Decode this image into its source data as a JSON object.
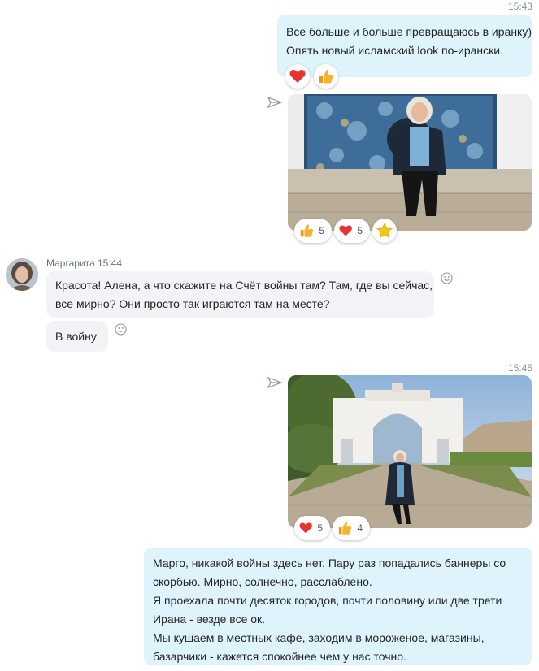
{
  "colors": {
    "outgoing_bubble": "#dff3fd",
    "incoming_bubble": "#f1f3f6",
    "timestamp": "#8a8f95",
    "heart": "#e8332f",
    "thumb": "#f6b42c",
    "star": "#f5c518"
  },
  "msg1": {
    "time": "15:43",
    "lines": [
      "Все больше и больше превращаюсь в иранку)",
      "Опять новый исламский look по-ирански."
    ],
    "reactions": [
      {
        "icon": "heart-icon"
      },
      {
        "icon": "thumbs-up-icon"
      }
    ]
  },
  "photo1": {
    "reactions": [
      {
        "icon": "thumbs-up-icon",
        "count": "5"
      },
      {
        "icon": "heart-icon",
        "count": "5"
      },
      {
        "icon": "star-icon"
      }
    ]
  },
  "incoming": {
    "sender_line": "Маргарита 15:44",
    "msg1_lines": [
      "Красота! Алена, а что скажите на Счёт войны там? Там, где вы сейчас,",
      "все мирно? Они просто так играются там на месте?"
    ],
    "msg2": "В войну"
  },
  "photo2": {
    "time": "15:45",
    "reactions": [
      {
        "icon": "heart-icon",
        "count": "5"
      },
      {
        "icon": "thumbs-up-icon",
        "count": "4"
      }
    ]
  },
  "msg_last": {
    "lines": [
      "Марго, никакой войны здесь нет. Пару раз попадались баннеры со",
      "скорбью. Мирно, солнечно, расслаблено.",
      "Я проехала почти десяток городов, почти половину или две трети",
      "Ирана - везде все ок.",
      "Мы кушаем в местных кафе, заходим в мороженое, магазины,",
      "базарчики - кажется спокойнее чем у нас точно."
    ]
  }
}
